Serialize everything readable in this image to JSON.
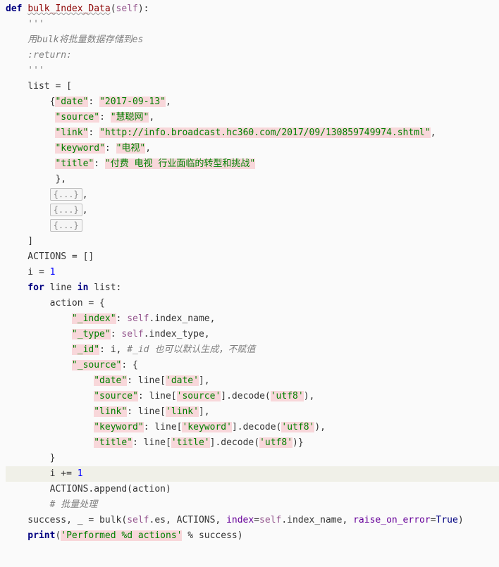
{
  "code": {
    "l01_def": "def ",
    "l01_fname": "bulk_Index_Data",
    "l01_open": "(",
    "l01_self": "self",
    "l01_close": "):",
    "l02_doc": "    '''",
    "l03_doc": "    用bulk将批量数据存储到es",
    "l04_doc": "    :return:",
    "l05_doc": "    '''",
    "l06_a": "    list = [",
    "l07_a": "        {",
    "l07_k1": "\"date\"",
    "l07_c1": ": ",
    "l07_v1": "\"2017-09-13\"",
    "l07_e": ",",
    "l08_pad": "         ",
    "l08_k": "\"source\"",
    "l08_c": ": ",
    "l08_v": "\"慧聪网\"",
    "l08_e": ",",
    "l09_pad": "         ",
    "l09_k": "\"link\"",
    "l09_c": ": ",
    "l09_v": "\"http://info.broadcast.hc360.com/2017/09/130859749974.shtml\"",
    "l09_e": ",",
    "l10_pad": "         ",
    "l10_k": "\"keyword\"",
    "l10_c": ": ",
    "l10_v": "\"电视\"",
    "l10_e": ",",
    "l11_pad": "         ",
    "l11_k": "\"title\"",
    "l11_c": ": ",
    "l11_v": "\"付费 电视 行业面临的转型和挑战\"",
    "l12_a": "         },",
    "l13_pad": "        ",
    "l13_fold": "{...}",
    "l13_e": ",",
    "l14_pad": "        ",
    "l14_fold": "{...}",
    "l14_e": ",",
    "l15_pad": "        ",
    "l15_fold": "{...}",
    "l16_a": "    ]",
    "l17_a": "    ACTIONS = []",
    "l18_a": "    i = ",
    "l18_n": "1",
    "l19_for": "    for ",
    "l19_line": "line ",
    "l19_in": "in ",
    "l19_list": "list:",
    "l20_a": "        action = {",
    "l21_pad": "            ",
    "l21_k": "\"_index\"",
    "l21_c": ": ",
    "l21_self": "self",
    "l21_rest": ".index_name,",
    "l22_pad": "            ",
    "l22_k": "\"_type\"",
    "l22_c": ": ",
    "l22_self": "self",
    "l22_rest": ".index_type,",
    "l23_pad": "            ",
    "l23_k": "\"_id\"",
    "l23_c": ": i, ",
    "l23_cm": "#_id 也可以默认生成，不赋值",
    "l24_pad": "            ",
    "l24_k": "\"_source\"",
    "l24_c": ": {",
    "l25_pad": "                ",
    "l25_k": "\"date\"",
    "l25_c": ": line[",
    "l25_v": "'date'",
    "l25_e": "],",
    "l26_pad": "                ",
    "l26_k": "\"source\"",
    "l26_c": ": line[",
    "l26_v": "'source'",
    "l26_e": "].decode(",
    "l26_u": "'utf8'",
    "l26_f": "),",
    "l27_pad": "                ",
    "l27_k": "\"link\"",
    "l27_c": ": line[",
    "l27_v": "'link'",
    "l27_e": "],",
    "l28_pad": "                ",
    "l28_k": "\"keyword\"",
    "l28_c": ": line[",
    "l28_v": "'keyword'",
    "l28_e": "].decode(",
    "l28_u": "'utf8'",
    "l28_f": "),",
    "l29_pad": "                ",
    "l29_k": "\"title\"",
    "l29_c": ": line[",
    "l29_v": "'title'",
    "l29_e": "].decode(",
    "l29_u": "'utf8'",
    "l29_f": ")}",
    "l30_a": "        }",
    "l31_a": "        i ",
    "l31_op": "+= ",
    "l31_n": "1",
    "l32_a": "        ACTIONS.append(action)",
    "l33_pad": "        ",
    "l33_cm": "# 批量处理",
    "l34_a": "    success, _ = bulk(",
    "l34_self": "self",
    "l34_b": ".es, ACTIONS, ",
    "l34_p1": "index",
    "l34_c": "=",
    "l34_self2": "self",
    "l34_d": ".index_name, ",
    "l34_p2": "raise_on_error",
    "l34_e": "=",
    "l34_tr": "True",
    "l34_f": ")",
    "l35_print": "    print",
    "l35_a": "(",
    "l35_s": "'Performed %d actions'",
    "l35_b": " % success)"
  }
}
